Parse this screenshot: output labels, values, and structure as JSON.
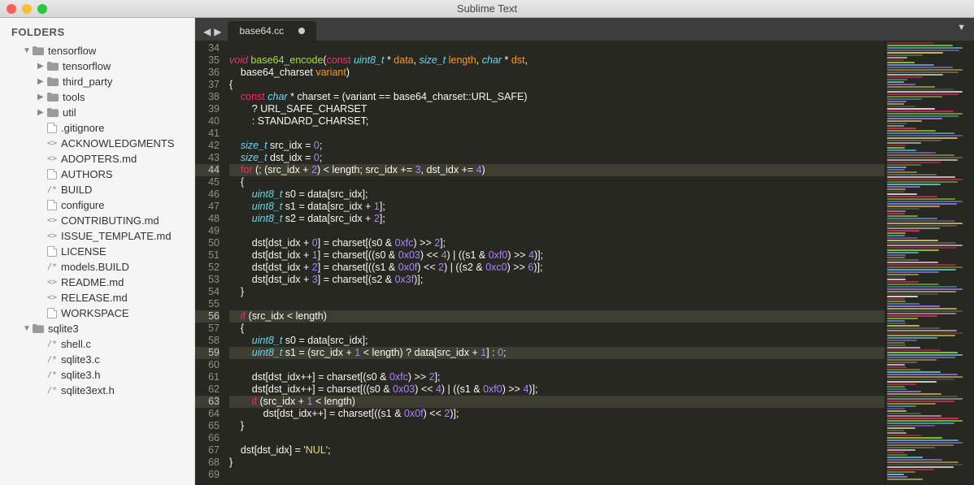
{
  "app": {
    "title": "Sublime Text"
  },
  "sidebar": {
    "header": "FOLDERS",
    "tree": [
      {
        "t": "folder",
        "name": "tensorflow",
        "open": true,
        "lvl": 0
      },
      {
        "t": "folder",
        "name": "tensorflow",
        "open": false,
        "lvl": 1
      },
      {
        "t": "folder",
        "name": "third_party",
        "open": false,
        "lvl": 1
      },
      {
        "t": "folder",
        "name": "tools",
        "open": false,
        "lvl": 1
      },
      {
        "t": "folder",
        "name": "util",
        "open": false,
        "lvl": 1
      },
      {
        "t": "file",
        "name": ".gitignore",
        "icon": "doc",
        "lvl": 1
      },
      {
        "t": "file",
        "name": "ACKNOWLEDGMENTS",
        "icon": "md",
        "lvl": 1
      },
      {
        "t": "file",
        "name": "ADOPTERS.md",
        "icon": "md",
        "lvl": 1
      },
      {
        "t": "file",
        "name": "AUTHORS",
        "icon": "doc",
        "lvl": 1
      },
      {
        "t": "file",
        "name": "BUILD",
        "icon": "code",
        "lvl": 1
      },
      {
        "t": "file",
        "name": "configure",
        "icon": "doc",
        "lvl": 1
      },
      {
        "t": "file",
        "name": "CONTRIBUTING.md",
        "icon": "md",
        "lvl": 1
      },
      {
        "t": "file",
        "name": "ISSUE_TEMPLATE.md",
        "icon": "md",
        "lvl": 1
      },
      {
        "t": "file",
        "name": "LICENSE",
        "icon": "doc",
        "lvl": 1
      },
      {
        "t": "file",
        "name": "models.BUILD",
        "icon": "code",
        "lvl": 1
      },
      {
        "t": "file",
        "name": "README.md",
        "icon": "md",
        "lvl": 1
      },
      {
        "t": "file",
        "name": "RELEASE.md",
        "icon": "md",
        "lvl": 1
      },
      {
        "t": "file",
        "name": "WORKSPACE",
        "icon": "doc",
        "lvl": 1
      },
      {
        "t": "folder",
        "name": "sqlite3",
        "open": true,
        "lvl": 0
      },
      {
        "t": "file",
        "name": "shell.c",
        "icon": "code",
        "lvl": 1
      },
      {
        "t": "file",
        "name": "sqlite3.c",
        "icon": "code",
        "lvl": 1
      },
      {
        "t": "file",
        "name": "sqlite3.h",
        "icon": "code",
        "lvl": 1
      },
      {
        "t": "file",
        "name": "sqlite3ext.h",
        "icon": "code",
        "lvl": 1
      }
    ]
  },
  "tab": {
    "name": "base64.cc",
    "dirty": true
  },
  "gutter": {
    "start": 34,
    "end": 69,
    "highlighted": [
      44,
      56,
      59,
      63
    ]
  },
  "code": {
    "lines": [
      {
        "n": 34,
        "seg": []
      },
      {
        "n": 35,
        "seg": [
          [
            "kw",
            "void"
          ],
          [
            "op",
            " "
          ],
          [
            "fn",
            "base64_encode"
          ],
          [
            "op",
            "("
          ],
          [
            "kw2",
            "const"
          ],
          [
            "op",
            " "
          ],
          [
            "ty",
            "uint8_t"
          ],
          [
            "op",
            " * "
          ],
          [
            "id",
            "data"
          ],
          [
            "op",
            ", "
          ],
          [
            "ty",
            "size_t"
          ],
          [
            "op",
            " "
          ],
          [
            "id",
            "length"
          ],
          [
            "op",
            ", "
          ],
          [
            "ty",
            "char"
          ],
          [
            "op",
            " * "
          ],
          [
            "id",
            "dst"
          ],
          [
            "op",
            ","
          ]
        ]
      },
      {
        "n": 36,
        "seg": [
          [
            "op",
            "    base64_charset "
          ],
          [
            "id",
            "variant"
          ],
          [
            "op",
            ")"
          ]
        ]
      },
      {
        "n": 37,
        "seg": [
          [
            "op",
            "{"
          ]
        ]
      },
      {
        "n": 38,
        "seg": [
          [
            "op",
            "    "
          ],
          [
            "kw2",
            "const"
          ],
          [
            "op",
            " "
          ],
          [
            "ty",
            "char"
          ],
          [
            "op",
            " * charset = (variant == base64_charset::URL_SAFE)"
          ]
        ]
      },
      {
        "n": 39,
        "seg": [
          [
            "op",
            "        ? URL_SAFE_CHARSET"
          ]
        ]
      },
      {
        "n": 40,
        "seg": [
          [
            "op",
            "        : STANDARD_CHARSET;"
          ]
        ]
      },
      {
        "n": 41,
        "seg": []
      },
      {
        "n": 42,
        "seg": [
          [
            "op",
            "    "
          ],
          [
            "ty",
            "size_t"
          ],
          [
            "op",
            " src_idx = "
          ],
          [
            "nm",
            "0"
          ],
          [
            "op",
            ";"
          ]
        ]
      },
      {
        "n": 43,
        "seg": [
          [
            "op",
            "    "
          ],
          [
            "ty",
            "size_t"
          ],
          [
            "op",
            " dst_idx = "
          ],
          [
            "nm",
            "0"
          ],
          [
            "op",
            ";"
          ]
        ]
      },
      {
        "n": 44,
        "hl": true,
        "seg": [
          [
            "op",
            "    "
          ],
          [
            "kw2",
            "for"
          ],
          [
            "op",
            " (; (src_idx + "
          ],
          [
            "nm",
            "2"
          ],
          [
            "op",
            ") < length; src_idx += "
          ],
          [
            "nm",
            "3"
          ],
          [
            "op",
            ", dst_idx += "
          ],
          [
            "nm",
            "4"
          ],
          [
            "op",
            ")"
          ]
        ]
      },
      {
        "n": 45,
        "seg": [
          [
            "op",
            "    {"
          ]
        ]
      },
      {
        "n": 46,
        "seg": [
          [
            "op",
            "        "
          ],
          [
            "ty",
            "uint8_t"
          ],
          [
            "op",
            " s0 = data[src_idx];"
          ]
        ]
      },
      {
        "n": 47,
        "seg": [
          [
            "op",
            "        "
          ],
          [
            "ty",
            "uint8_t"
          ],
          [
            "op",
            " s1 = data[src_idx + "
          ],
          [
            "nm",
            "1"
          ],
          [
            "op",
            "];"
          ]
        ]
      },
      {
        "n": 48,
        "seg": [
          [
            "op",
            "        "
          ],
          [
            "ty",
            "uint8_t"
          ],
          [
            "op",
            " s2 = data[src_idx + "
          ],
          [
            "nm",
            "2"
          ],
          [
            "op",
            "];"
          ]
        ]
      },
      {
        "n": 49,
        "seg": []
      },
      {
        "n": 50,
        "seg": [
          [
            "op",
            "        dst[dst_idx + "
          ],
          [
            "nm",
            "0"
          ],
          [
            "op",
            "] = charset[(s0 & "
          ],
          [
            "nm",
            "0xfc"
          ],
          [
            "op",
            ") >> "
          ],
          [
            "nm",
            "2"
          ],
          [
            "op",
            "];"
          ]
        ]
      },
      {
        "n": 51,
        "seg": [
          [
            "op",
            "        dst[dst_idx + "
          ],
          [
            "nm",
            "1"
          ],
          [
            "op",
            "] = charset[((s0 & "
          ],
          [
            "nm",
            "0x03"
          ],
          [
            "op",
            ") << "
          ],
          [
            "nm",
            "4"
          ],
          [
            "op",
            ") | ((s1 & "
          ],
          [
            "nm",
            "0xf0"
          ],
          [
            "op",
            ") >> "
          ],
          [
            "nm",
            "4"
          ],
          [
            "op",
            ")];"
          ]
        ]
      },
      {
        "n": 52,
        "seg": [
          [
            "op",
            "        dst[dst_idx + "
          ],
          [
            "nm",
            "2"
          ],
          [
            "op",
            "] = charset[((s1 & "
          ],
          [
            "nm",
            "0x0f"
          ],
          [
            "op",
            ") << "
          ],
          [
            "nm",
            "2"
          ],
          [
            "op",
            ") | ((s2 & "
          ],
          [
            "nm",
            "0xc0"
          ],
          [
            "op",
            ") >> "
          ],
          [
            "nm",
            "6"
          ],
          [
            "op",
            ")];"
          ]
        ]
      },
      {
        "n": 53,
        "seg": [
          [
            "op",
            "        dst[dst_idx + "
          ],
          [
            "nm",
            "3"
          ],
          [
            "op",
            "] = charset[(s2 & "
          ],
          [
            "nm",
            "0x3f"
          ],
          [
            "op",
            ")];"
          ]
        ]
      },
      {
        "n": 54,
        "seg": [
          [
            "op",
            "    }"
          ]
        ]
      },
      {
        "n": 55,
        "seg": []
      },
      {
        "n": 56,
        "hl": true,
        "seg": [
          [
            "op",
            "    "
          ],
          [
            "kw2",
            "if"
          ],
          [
            "op",
            " (src_idx < length)"
          ]
        ]
      },
      {
        "n": 57,
        "seg": [
          [
            "op",
            "    {"
          ]
        ]
      },
      {
        "n": 58,
        "seg": [
          [
            "op",
            "        "
          ],
          [
            "ty",
            "uint8_t"
          ],
          [
            "op",
            " s0 = data[src_idx];"
          ]
        ]
      },
      {
        "n": 59,
        "hl": true,
        "seg": [
          [
            "op",
            "        "
          ],
          [
            "ty",
            "uint8_t"
          ],
          [
            "op",
            " s1 = (src_idx + "
          ],
          [
            "nm",
            "1"
          ],
          [
            "op",
            " < length) ? data[src_idx + "
          ],
          [
            "nm",
            "1"
          ],
          [
            "op",
            "] : "
          ],
          [
            "nm",
            "0"
          ],
          [
            "op",
            ";"
          ]
        ]
      },
      {
        "n": 60,
        "seg": []
      },
      {
        "n": 61,
        "seg": [
          [
            "op",
            "        dst[dst_idx++] = charset[(s0 & "
          ],
          [
            "nm",
            "0xfc"
          ],
          [
            "op",
            ") >> "
          ],
          [
            "nm",
            "2"
          ],
          [
            "op",
            "];"
          ]
        ]
      },
      {
        "n": 62,
        "seg": [
          [
            "op",
            "        dst[dst_idx++] = charset[((s0 & "
          ],
          [
            "nm",
            "0x03"
          ],
          [
            "op",
            ") << "
          ],
          [
            "nm",
            "4"
          ],
          [
            "op",
            ") | ((s1 & "
          ],
          [
            "nm",
            "0xf0"
          ],
          [
            "op",
            ") >> "
          ],
          [
            "nm",
            "4"
          ],
          [
            "op",
            ")];"
          ]
        ]
      },
      {
        "n": 63,
        "hl": true,
        "seg": [
          [
            "op",
            "        "
          ],
          [
            "kw2",
            "if"
          ],
          [
            "op",
            " (src_idx + "
          ],
          [
            "nm",
            "1"
          ],
          [
            "op",
            " < length)"
          ]
        ]
      },
      {
        "n": 64,
        "seg": [
          [
            "op",
            "            dst[dst_idx++] = charset[((s1 & "
          ],
          [
            "nm",
            "0x0f"
          ],
          [
            "op",
            ") << "
          ],
          [
            "nm",
            "2"
          ],
          [
            "op",
            ")];"
          ]
        ]
      },
      {
        "n": 65,
        "seg": [
          [
            "op",
            "    }"
          ]
        ]
      },
      {
        "n": 66,
        "seg": []
      },
      {
        "n": 67,
        "seg": [
          [
            "op",
            "    dst[dst_idx] = "
          ],
          [
            "st",
            "'NUL'"
          ],
          [
            "op",
            ";"
          ]
        ]
      },
      {
        "n": 68,
        "seg": [
          [
            "op",
            "}"
          ]
        ]
      },
      {
        "n": 69,
        "seg": []
      }
    ]
  },
  "minimap": {
    "colors": [
      "#f92672",
      "#a6e22e",
      "#66d9ef",
      "#ae81ff",
      "#e6db74",
      "#75715e",
      "#f8f8f2"
    ]
  }
}
